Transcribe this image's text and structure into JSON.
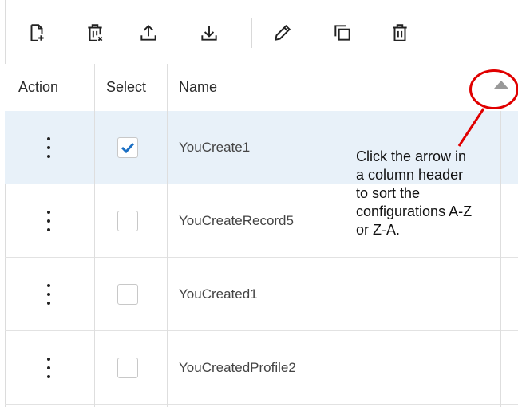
{
  "toolbar": {
    "buttons": [
      {
        "name": "new-file-icon",
        "label": "New"
      },
      {
        "name": "delete-selected-icon",
        "label": "Delete selected"
      },
      {
        "name": "upload-icon",
        "label": "Import"
      },
      {
        "name": "download-icon",
        "label": "Export"
      },
      {
        "name": "edit-icon",
        "label": "Edit"
      },
      {
        "name": "copy-icon",
        "label": "Copy"
      },
      {
        "name": "trash-icon",
        "label": "Delete"
      }
    ]
  },
  "grid": {
    "headers": {
      "action": "Action",
      "select": "Select",
      "name": "Name"
    },
    "sort_direction": "ascending",
    "rows": [
      {
        "name": "YouCreate1",
        "selected": true
      },
      {
        "name": "YouCreateRecord5",
        "selected": false
      },
      {
        "name": "YouCreated1",
        "selected": false
      },
      {
        "name": "YouCreatedProfile2",
        "selected": false
      }
    ]
  },
  "annotation": {
    "text": "Click the arrow in\na column header\nto sort the\nconfigurations A-Z\nor Z-A.",
    "color": "#e00000"
  },
  "colors": {
    "selected_row_bg": "#e8f1f9",
    "checkbox_check": "#1a6fc4",
    "border": "#d8d8d8"
  }
}
